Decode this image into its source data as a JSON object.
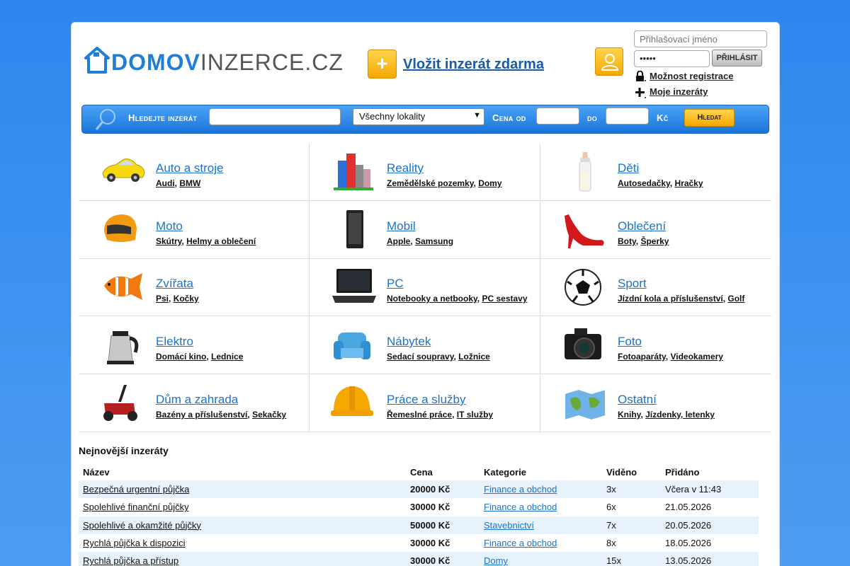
{
  "brand": {
    "logo_a": "DOMOV",
    "logo_b": "INZERCE.CZ"
  },
  "header": {
    "add_symbol": "+",
    "add_label": "Vložit inzerát zdarma",
    "login_placeholder": "Přihlašovací jméno",
    "password_value": "•••••",
    "login_button": "PŘIHLÁSIT",
    "register_link": "Možnost registrace",
    "my_ads_link": "Moje inzeráty"
  },
  "search": {
    "label": "Hledejte inzerát",
    "location_selected": "Všechny lokality",
    "price_from_label": "Cena od",
    "price_to_label": "do",
    "currency": "Kč",
    "button": "Hledat"
  },
  "categories": [
    {
      "title": "Auto a stroje",
      "subs": [
        "Audi",
        "BMW"
      ],
      "icon": "car-icon"
    },
    {
      "title": "Reality",
      "subs": [
        "Zemědělské pozemky",
        "Domy"
      ],
      "icon": "buildings-icon"
    },
    {
      "title": "Děti",
      "subs": [
        "Autosedačky",
        "Hračky"
      ],
      "icon": "baby-bottle-icon"
    },
    {
      "title": "Moto",
      "subs": [
        "Skútry",
        "Helmy a oblečení"
      ],
      "icon": "helmet-icon"
    },
    {
      "title": "Mobil",
      "subs": [
        "Apple",
        "Samsung"
      ],
      "icon": "phone-icon"
    },
    {
      "title": "Oblečení",
      "subs": [
        "Boty",
        "Šperky"
      ],
      "icon": "high-heel-icon"
    },
    {
      "title": "Zvířata",
      "subs": [
        "Psi",
        "Kočky"
      ],
      "icon": "fish-icon"
    },
    {
      "title": "PC",
      "subs": [
        "Notebooky a netbooky",
        "PC sestavy"
      ],
      "icon": "laptop-icon"
    },
    {
      "title": "Sport",
      "subs": [
        "Jízdní kola a příslušenství",
        "Golf"
      ],
      "icon": "soccer-ball-icon"
    },
    {
      "title": "Elektro",
      "subs": [
        "Domácí kino",
        "Lednice"
      ],
      "icon": "kettle-icon"
    },
    {
      "title": "Nábytek",
      "subs": [
        "Sedací soupravy",
        "Ložnice"
      ],
      "icon": "armchair-icon"
    },
    {
      "title": "Foto",
      "subs": [
        "Fotoaparáty",
        "Videokamery"
      ],
      "icon": "camera-icon"
    },
    {
      "title": "Dům a zahrada",
      "subs": [
        "Bazény a příslušenství",
        "Sekačky"
      ],
      "icon": "lawnmower-icon"
    },
    {
      "title": "Práce a služby",
      "subs": [
        "Řemeslné práce",
        "IT služby"
      ],
      "icon": "hard-hat-icon"
    },
    {
      "title": "Ostatní",
      "subs": [
        "Knihy",
        "Jízdenky, letenky"
      ],
      "icon": "map-icon"
    }
  ],
  "newest": {
    "title": "Nejnovější inzeráty",
    "columns": [
      "Název",
      "Cena",
      "Kategorie",
      "Viděno",
      "Přidáno"
    ],
    "rows": [
      {
        "name": "Bezpečná urgentní půjčka",
        "price": "20000 Kč",
        "category": "Finance a obchod",
        "views": "3x",
        "added": "Včera v 11:43"
      },
      {
        "name": "Spolehlivé finanční půjčky",
        "price": "30000 Kč",
        "category": "Finance a obchod",
        "views": "6x",
        "added": "21.05.2026"
      },
      {
        "name": "Spolehlivé a okamžité půjčky",
        "price": "50000 Kč",
        "category": "Stavebnictví",
        "views": "7x",
        "added": "20.05.2026"
      },
      {
        "name": "Rychlá půjčka k dispozici",
        "price": "30000 Kč",
        "category": "Finance a obchod",
        "views": "8x",
        "added": "18.05.2026"
      },
      {
        "name": "Rychlá půjčka a přístup",
        "price": "30000 Kč",
        "category": "Domy",
        "views": "15x",
        "added": "13.05.2026"
      }
    ]
  },
  "colors": {
    "accent": "#1a74db",
    "link": "#1a73cc",
    "button": "#f5a800",
    "row_alt": "#e7f2fc"
  }
}
